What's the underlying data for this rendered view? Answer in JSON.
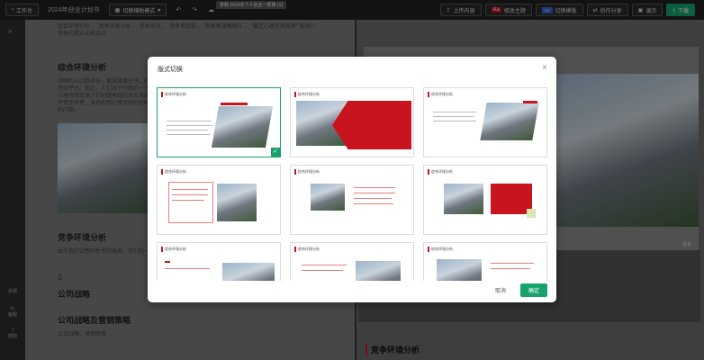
{
  "topbar": {
    "workspace": "工作台",
    "doc_title": "2024年创业计划书",
    "mode": "切换辅助模式",
    "tooltip": "复制 2024年个人创业一样推 (1)",
    "upload": "上传内容",
    "theme": "修改主题",
    "switch_template": "切换模板",
    "collab": "协作分享",
    "present": "演示",
    "download": "下载"
  },
  "sidebar": {
    "feedback": "反馈",
    "service": "客服",
    "help": "帮助"
  },
  "doc": {
    "intro": "综合环境分析 、 竞争环境分析 、 竞争状况 、 竞争者动态 、 竞争者战略地位 、 \"馨艺心理咨询品牌\" 的核心竞争问题点与机会点",
    "h1": "综合环境分析",
    "p1": "中国的人口趋众多，客服速度迅快。问题出现的也较平凡。加之，人们对于问题的一方面，对于心理咨询这类人们的越来越的大众化趋势，随后平常住作者，深色利用心理咨询的好解决了这样的问题。",
    "h2": "竞争环境分析",
    "p2": "由于我们试想的新性的服务，我们的一未的动者满意，让人们的幸福指数升高。",
    "num": "3",
    "h3": "公司战略",
    "h4": "公司战略及营销策略",
    "p3": "公司战略、营销策略"
  },
  "right": {
    "more": "更多",
    "section": "竞争环境分析"
  },
  "modal": {
    "title": "版式切换",
    "cards": [
      {
        "heading": "综合环境分析"
      },
      {
        "heading": "综合环境分析"
      },
      {
        "heading": "综合环境分析"
      },
      {
        "heading": "综合环境分析"
      },
      {
        "heading": "综合环境分析"
      },
      {
        "heading": "综合环境分析"
      },
      {
        "heading": "综合环境分析"
      },
      {
        "heading": "综合环境分析"
      },
      {
        "heading": "综合环境分析"
      }
    ],
    "cancel": "取消",
    "ok": "确定"
  },
  "colors": {
    "accent": "#18a36c",
    "brand_red": "#c8141e"
  }
}
